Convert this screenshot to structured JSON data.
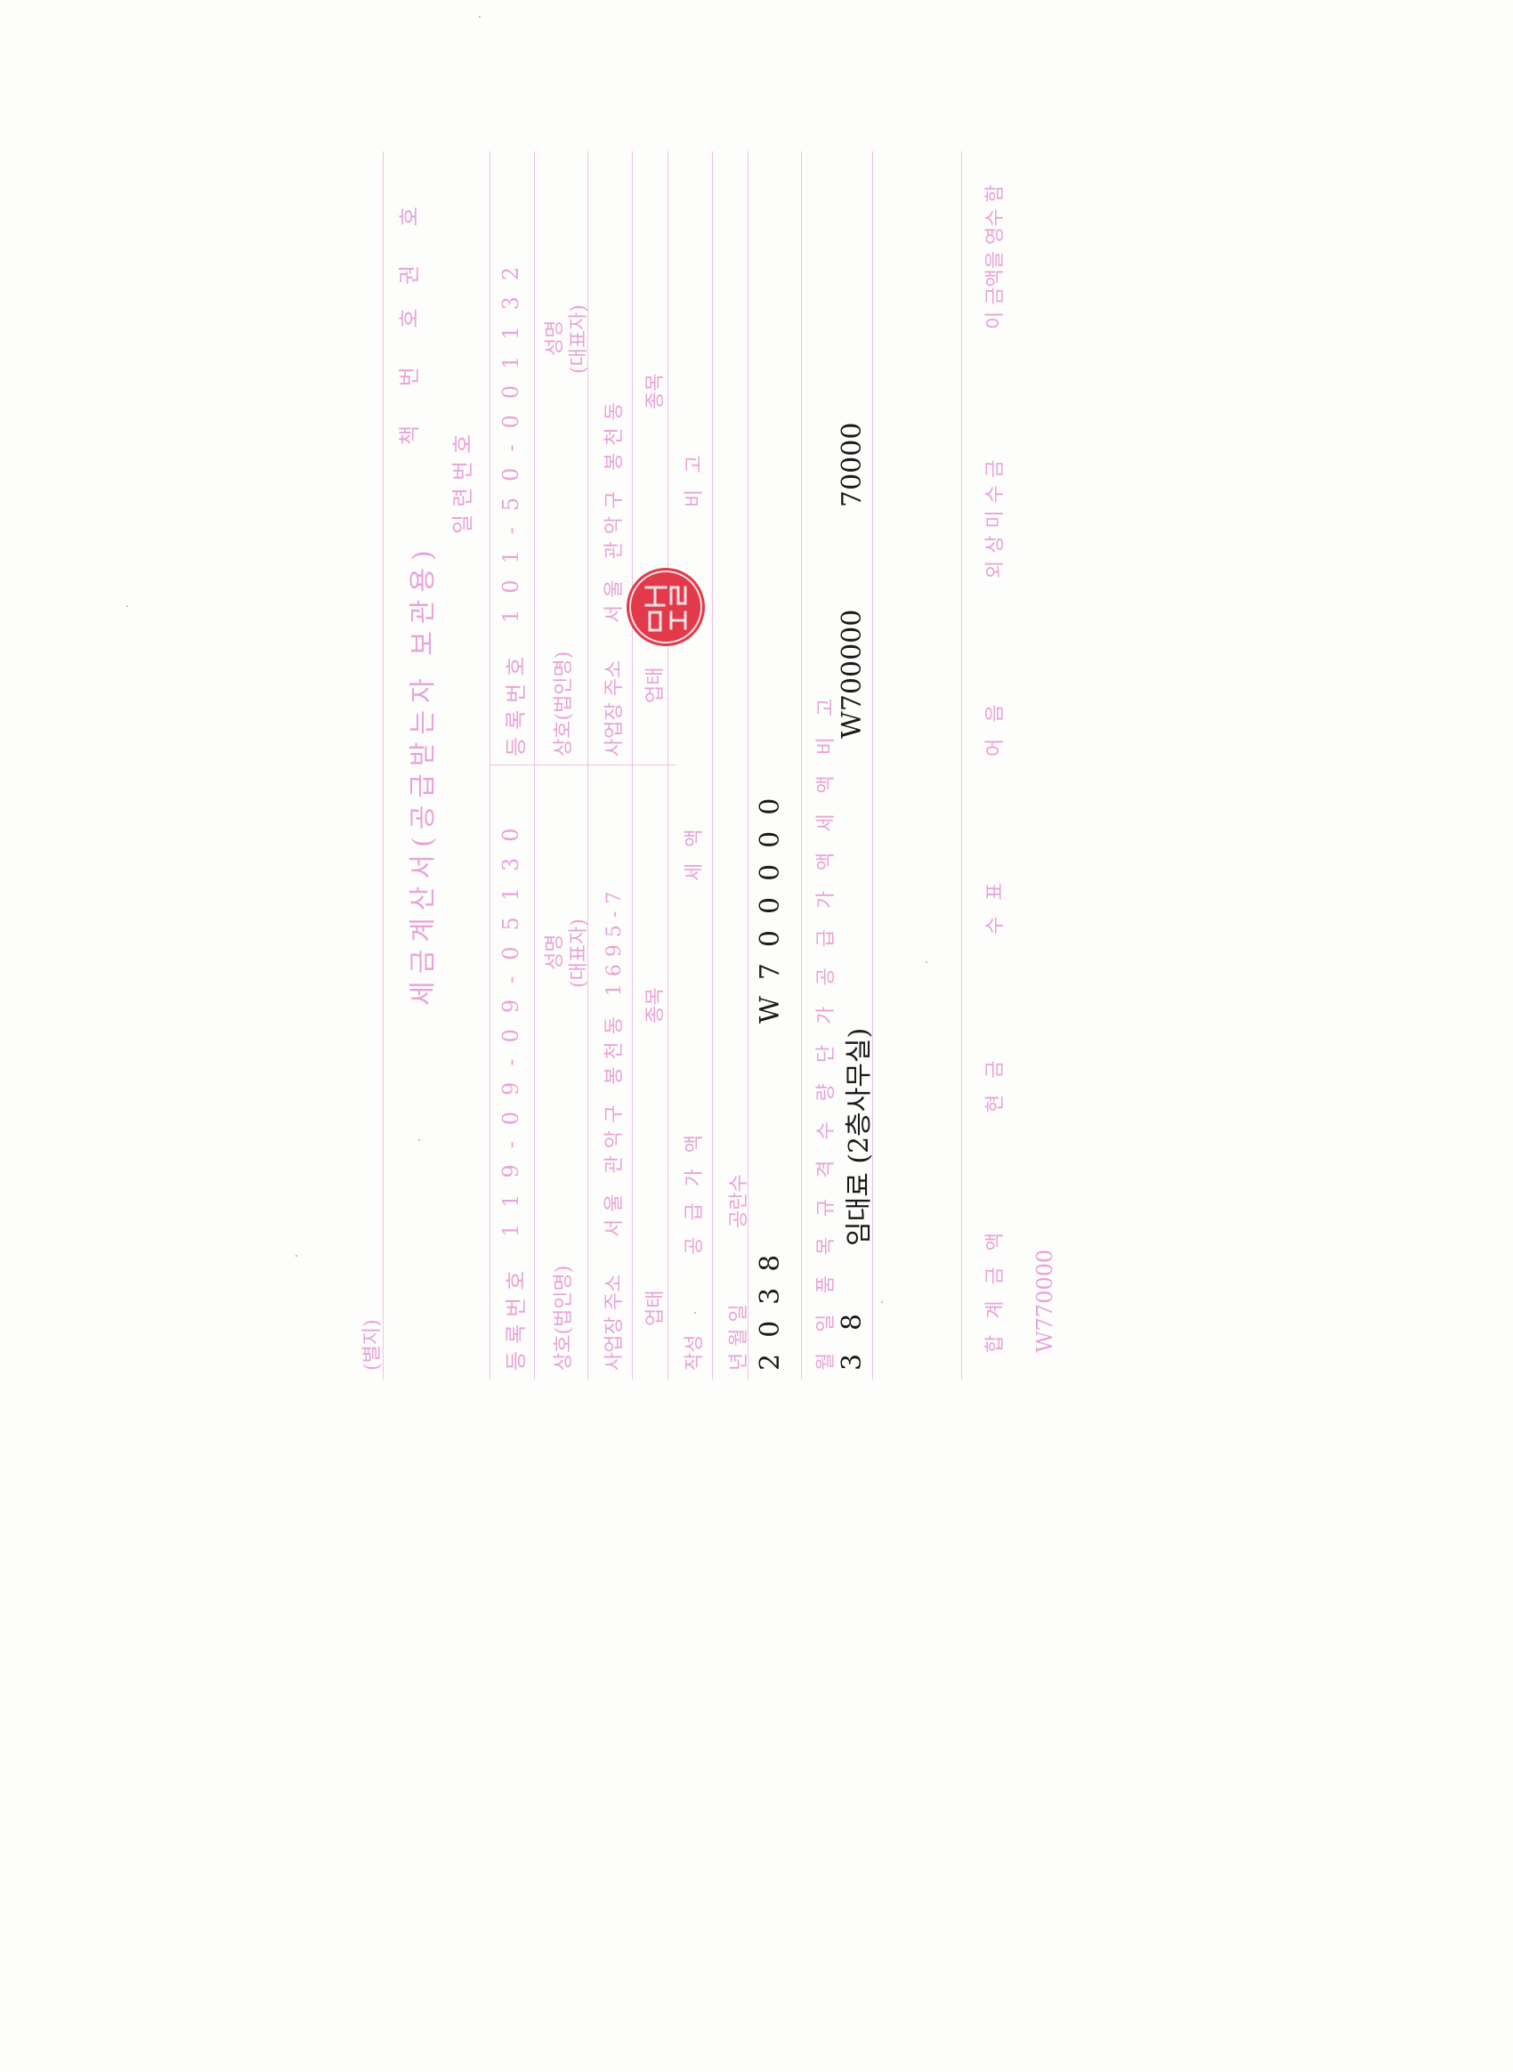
{
  "form": {
    "corner_label": "(별지)",
    "title": "세금계산서(공급받는자 보관용)",
    "book_no": "책 번 호",
    "book_suffix": "권 호",
    "serial_label": "일련번호",
    "supplier_reg_label": "등록번호",
    "supplier_reg_no": "119-09-09-05130",
    "buyer_reg_label": "등록번호",
    "buyer_reg_no": "101-50-001132",
    "company_label": "상호(법인명)",
    "name_label": "성명",
    "rep_label": "(대표자)",
    "address_label": "사업장 주소",
    "supplier_address": "서울 관악구 봉천동 1695-7",
    "buyer_address": "서울 관악구 봉천동",
    "business_type_label": "업태",
    "business_item_label": "종목",
    "supply_value_label": "공급가액",
    "tax_label": "세액",
    "remarks_label": "비고",
    "date_label": "작성",
    "year_month_day_label": "년 월 일",
    "blank_label": "공란수",
    "header_row": "월 일 품 목 규 격 수 량 단 가 공 급 가 액 세 액 비 고",
    "total_label": "합계금액",
    "cash_label": "현금",
    "check_label": "수표",
    "note_label": "어음",
    "credit_label": "외상미수금",
    "receipt_label": "이 금액을 영수 함",
    "footer_total": "W770000"
  },
  "filled": {
    "year": "2038",
    "supply_value_total": "W700000",
    "month": "3",
    "day": "8",
    "item": "임대료 (2층사무실)",
    "supply_value": "W700000",
    "tax": "70000"
  },
  "colors": {
    "form_print": "#e8a3d8",
    "seal_red": "#e23a4a",
    "ink": "#1a1a1a"
  }
}
